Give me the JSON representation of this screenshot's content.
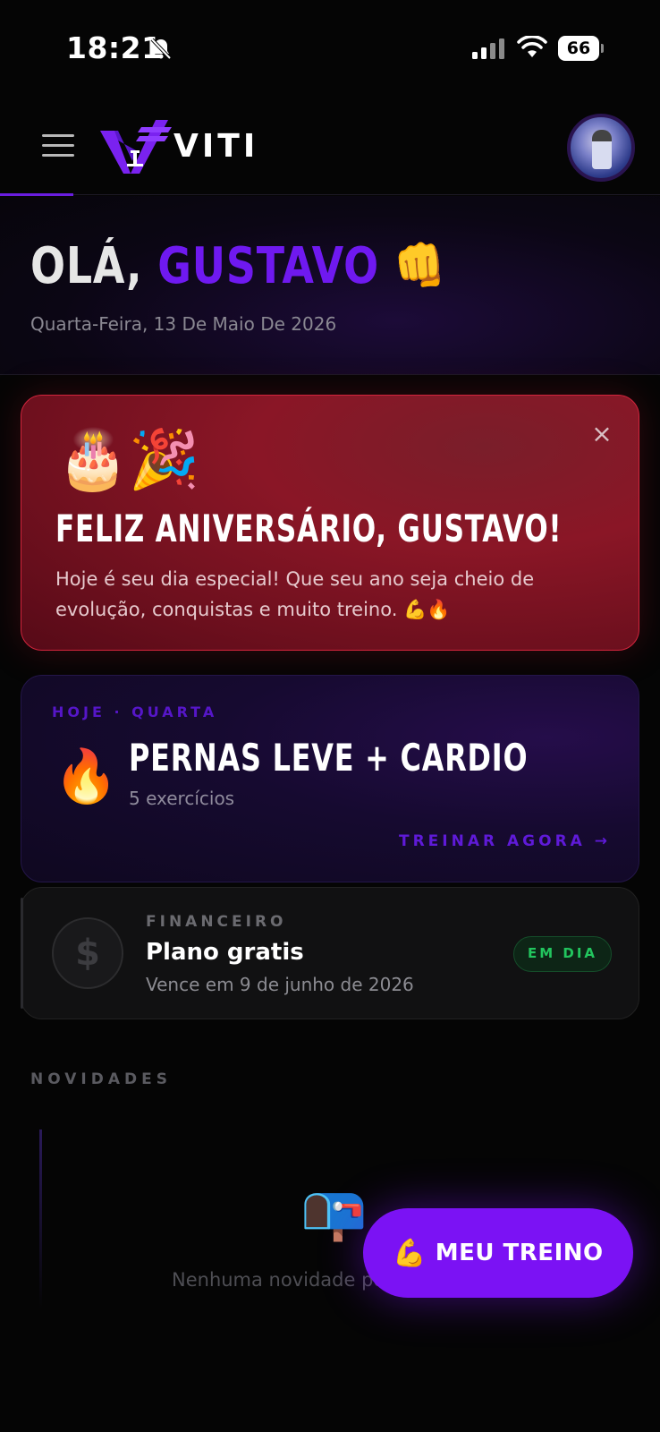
{
  "status_bar": {
    "time": "18:21",
    "battery_level": "66"
  },
  "header": {
    "logo_text": "VITI"
  },
  "greeting": {
    "hello": "OLÁ,",
    "name": "GUSTAVO",
    "emoji": "👊",
    "date": "Quarta-Feira, 13 De Maio De 2026"
  },
  "birthday_card": {
    "emoji": "🎂🎉",
    "close": "×",
    "title": "FELIZ ANIVERSÁRIO, GUSTAVO!",
    "message": "Hoje é seu dia especial! Que seu ano seja cheio de evolução, conquistas e muito treino. 💪🔥"
  },
  "workout_card": {
    "label": "HOJE · QUARTA",
    "emoji": "🔥",
    "title": "PERNAS LEVE + CARDIO",
    "subtitle": "5 exercícios",
    "cta": "TREINAR AGORA →"
  },
  "finance_card": {
    "icon": "$",
    "label": "FINANCEIRO",
    "plan": "Plano gratis",
    "due": "Vence em 9 de junho de 2026",
    "badge": "EM DIA"
  },
  "news": {
    "label": "NOVIDADES",
    "emoji": "📭",
    "empty_text": "Nenhuma novidade po"
  },
  "fab": {
    "emoji": "💪",
    "label": "MEU TREINO"
  },
  "colors": {
    "accent_purple": "#6f19f0",
    "fab_purple": "#7b12f4",
    "birthday_red": "#8a1626",
    "status_green": "#22c55e"
  },
  "icons": {
    "menu": "hamburger-icon",
    "silent": "bell-slash-icon",
    "signal": "cellular-signal-icon",
    "wifi": "wifi-icon",
    "battery": "battery-icon",
    "close": "close-icon",
    "dollar": "dollar-icon"
  }
}
